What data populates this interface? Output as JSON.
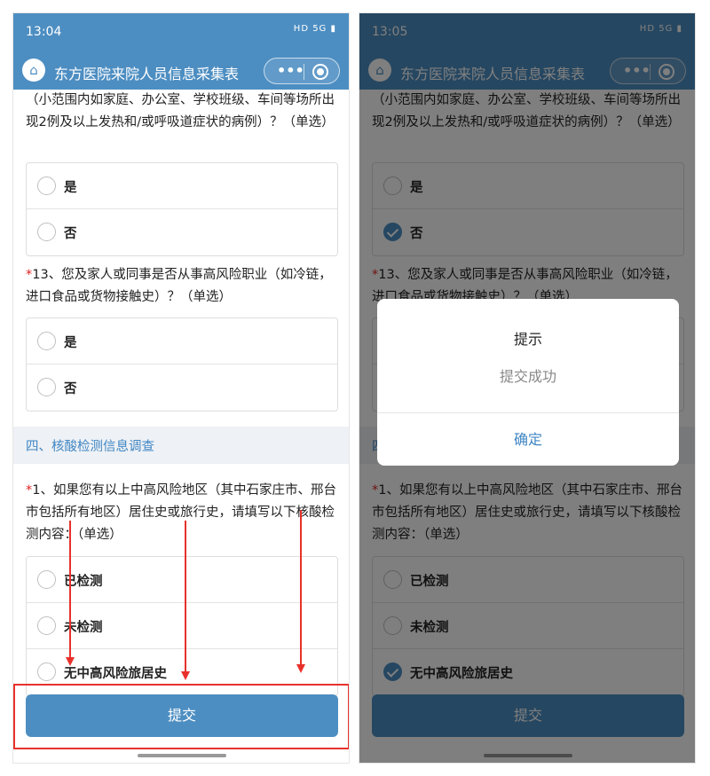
{
  "app": {
    "title": "东方医院来院人员信息采集表",
    "capsule_menu": "•••"
  },
  "screens": {
    "left": {
      "time": "13:04",
      "status_icons": "HD 5G ▮"
    },
    "right": {
      "time": "13:05",
      "status_icons": "HD 5G ▮"
    }
  },
  "form": {
    "q12_text_tail": "（小范围内如家庭、办公室、学校班级、车间等场所出现2例及以上发热和/或呼吸道症状的病例）？（单选）",
    "q13_required": "*",
    "q13_text": "13、您及家人或同事是否从事高风险职业（如冷链，进口食品或货物接触史）？（单选）",
    "yes": "是",
    "no": "否",
    "section4_title": "四、核酸检测信息调查",
    "s4q1_required": "*",
    "s4q1_text": "1、如果您有以上中高风险地区（其中石家庄市、邢台市包括所有地区）居住史或旅行史，请填写以下核酸检测内容：（单选）",
    "opt_tested": "已检测",
    "opt_not_tested": "未检测",
    "opt_no_history": "无中高风险旅居史",
    "submit_label": "提交"
  },
  "selections": {
    "right_q12": "否",
    "right_s4q1": "无中高风险旅居史"
  },
  "dialog": {
    "title": "提示",
    "message": "提交成功",
    "confirm_label": "确定"
  },
  "colors": {
    "primary": "#4d8ec2",
    "section_text": "#3f86c4",
    "required": "#e02020",
    "annotation": "#e8312b"
  }
}
